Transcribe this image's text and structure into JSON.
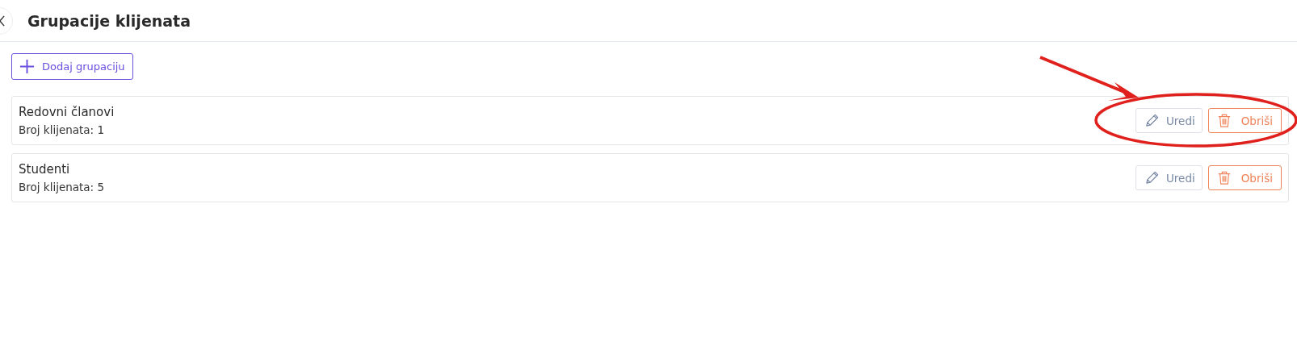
{
  "header": {
    "title": "Grupacije klijenata"
  },
  "add_button": {
    "label": "Dodaj grupaciju"
  },
  "groups": [
    {
      "name": "Redovni članovi",
      "count": "Broj klijenata: 1",
      "edit_label": "Uredi",
      "delete_label": "Obriši"
    },
    {
      "name": "Studenti",
      "count": "Broj klijenata: 5",
      "edit_label": "Uredi",
      "delete_label": "Obriši"
    }
  ]
}
